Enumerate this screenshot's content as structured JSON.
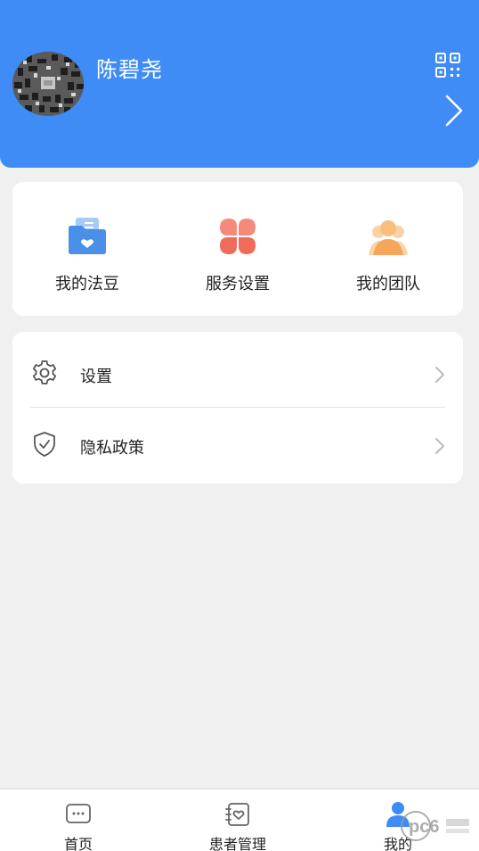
{
  "colors": {
    "brand": "#3f8cf6",
    "background": "#f0f0f0",
    "card": "#ffffff",
    "text": "#222222",
    "icon_gray": "#666666",
    "fadou": "#4a90e8",
    "service": "#f06b5a",
    "team": "#f5a65b"
  },
  "profile": {
    "name": "陈碧尧",
    "avatar_icon": "avatar-photo",
    "qr_icon": "qr-code-icon",
    "arrow_icon": "chevron-right-icon"
  },
  "quick_actions": [
    {
      "label": "我的法豆",
      "icon": "folder-heart-icon"
    },
    {
      "label": "服务设置",
      "icon": "grid-petals-icon"
    },
    {
      "label": "我的团队",
      "icon": "team-icon"
    }
  ],
  "menu": [
    {
      "label": "设置",
      "icon": "gear-icon"
    },
    {
      "label": "隐私政策",
      "icon": "shield-check-icon"
    }
  ],
  "tabs": [
    {
      "label": "首页",
      "icon": "chat-dots-icon",
      "active": false
    },
    {
      "label": "患者管理",
      "icon": "heart-doc-icon",
      "active": false
    },
    {
      "label": "我的",
      "icon": "person-icon",
      "active": true
    }
  ],
  "watermark": {
    "text": "pc6"
  }
}
